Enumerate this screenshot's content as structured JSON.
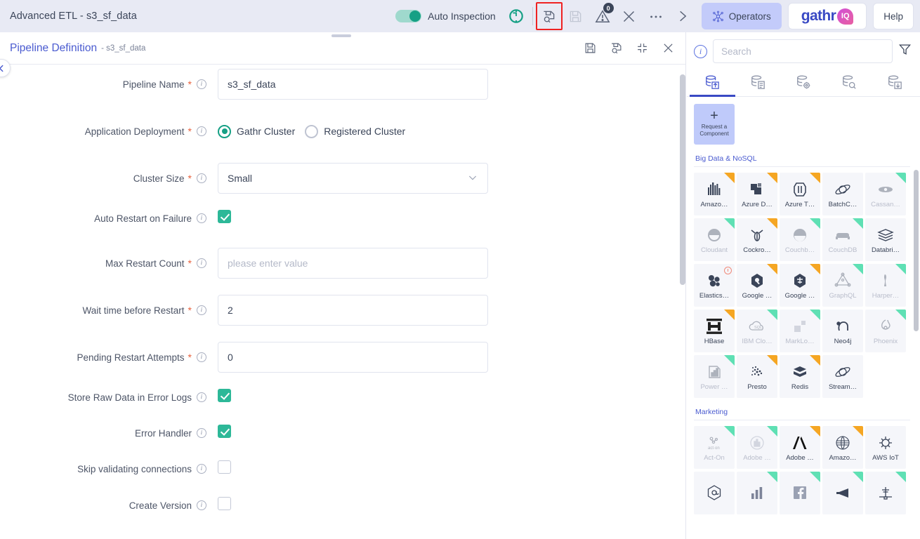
{
  "topbar": {
    "title": "Advanced ETL - s3_sf_data",
    "auto_inspection_label": "Auto Inspection",
    "icons": {
      "refresh": "refresh-icon",
      "save_as": "save-as-icon",
      "save": "save-icon",
      "warnings": "warning-icon",
      "close": "close-icon",
      "more": "more-icon",
      "next": "chevron-right-icon"
    },
    "warning_count": "0",
    "operators_label": "Operators",
    "gathr_label": "gathr",
    "gathr_iq_label": "IQ",
    "help_label": "Help",
    "accent": "#3949c4",
    "highlight_color": "#ef2222"
  },
  "panel": {
    "title": "Pipeline Definition",
    "subtitle": "- s3_sf_data",
    "actions": [
      "save-icon",
      "save-as-icon",
      "collapse-icon",
      "close-icon"
    ]
  },
  "form": {
    "fields": [
      {
        "label": "Pipeline Name",
        "required": true,
        "type": "text",
        "value": "s3_sf_data",
        "placeholder": ""
      },
      {
        "label": "Application Deployment",
        "required": true,
        "type": "radio",
        "options": [
          "Gathr Cluster",
          "Registered Cluster"
        ],
        "selected": "Gathr Cluster"
      },
      {
        "label": "Cluster Size",
        "required": true,
        "type": "select",
        "value": "Small"
      },
      {
        "label": "Auto Restart on Failure",
        "required": false,
        "type": "checkbox",
        "checked": true
      },
      {
        "label": "Max Restart Count",
        "required": true,
        "type": "text",
        "value": "",
        "placeholder": "please enter value"
      },
      {
        "label": "Wait time before Restart",
        "required": true,
        "type": "text",
        "value": "2",
        "placeholder": ""
      },
      {
        "label": "Pending Restart Attempts",
        "required": true,
        "type": "text",
        "value": "0",
        "placeholder": ""
      },
      {
        "label": "Store Raw Data in Error Logs",
        "required": false,
        "type": "checkbox",
        "checked": true
      },
      {
        "label": "Error Handler",
        "required": false,
        "type": "checkbox",
        "checked": true
      },
      {
        "label": "Skip validating connections",
        "required": false,
        "type": "checkbox",
        "checked": false
      },
      {
        "label": "Create Version",
        "required": false,
        "type": "checkbox",
        "checked": false
      }
    ]
  },
  "operators": {
    "search_placeholder": "Search",
    "info_icon": "info-icon",
    "filter_icon": "filter-icon",
    "tabs": [
      {
        "name": "sources-tab",
        "icon": "database-upload-icon",
        "active": true
      },
      {
        "name": "processors-tab",
        "icon": "database-document-icon",
        "active": false
      },
      {
        "name": "config-tab",
        "icon": "database-gear-icon",
        "active": false
      },
      {
        "name": "inspect-tab",
        "icon": "database-search-icon",
        "active": false
      },
      {
        "name": "emitters-tab",
        "icon": "database-download-icon",
        "active": false
      }
    ],
    "request_tile": {
      "plus": "+",
      "label": "Request a\nComponent"
    },
    "sections": [
      {
        "title": "Big Data & NoSQL",
        "items": [
          {
            "name": "Amazo…",
            "corner": "orange",
            "dim": false,
            "glyph": "amazon-redshift-icon"
          },
          {
            "name": "Azure D…",
            "corner": "orange",
            "dim": false,
            "glyph": "azure-data-icon"
          },
          {
            "name": "Azure T…",
            "corner": "orange",
            "dim": false,
            "glyph": "azure-table-icon"
          },
          {
            "name": "BatchC…",
            "corner": "none",
            "dim": false,
            "glyph": "batch-cosmos-icon"
          },
          {
            "name": "Cassan…",
            "corner": "green",
            "dim": true,
            "glyph": "cassandra-icon"
          },
          {
            "name": "Cloudant",
            "corner": "green",
            "dim": true,
            "glyph": "cloudant-icon"
          },
          {
            "name": "Cockro…",
            "corner": "orange",
            "dim": false,
            "glyph": "cockroachdb-icon"
          },
          {
            "name": "Couchb…",
            "corner": "green",
            "dim": true,
            "glyph": "couchbase-icon"
          },
          {
            "name": "CouchDB",
            "corner": "green",
            "dim": true,
            "glyph": "couchdb-icon"
          },
          {
            "name": "Databri…",
            "corner": "none",
            "dim": false,
            "glyph": "databricks-icon"
          },
          {
            "name": "Elastics…",
            "corner": "clock",
            "dim": false,
            "glyph": "elasticsearch-icon"
          },
          {
            "name": "Google …",
            "corner": "orange",
            "dim": false,
            "glyph": "google-bigquery-icon"
          },
          {
            "name": "Google …",
            "corner": "orange",
            "dim": false,
            "glyph": "google-bigtable-icon"
          },
          {
            "name": "GraphQL",
            "corner": "green",
            "dim": true,
            "glyph": "graphql-icon"
          },
          {
            "name": "Harper…",
            "corner": "green",
            "dim": true,
            "glyph": "harperdb-icon"
          },
          {
            "name": "HBase",
            "corner": "orange",
            "dim": false,
            "glyph": "hbase-icon"
          },
          {
            "name": "IBM Clo…",
            "corner": "green",
            "dim": true,
            "glyph": "ibm-cloud-sql-icon"
          },
          {
            "name": "MarkLo…",
            "corner": "green",
            "dim": true,
            "glyph": "marklogic-icon"
          },
          {
            "name": "Neo4j",
            "corner": "none",
            "dim": false,
            "glyph": "neo4j-icon"
          },
          {
            "name": "Phoenix",
            "corner": "green",
            "dim": true,
            "glyph": "phoenix-icon"
          },
          {
            "name": "Power …",
            "corner": "green",
            "dim": true,
            "glyph": "power-bi-icon"
          },
          {
            "name": "Presto",
            "corner": "orange",
            "dim": false,
            "glyph": "presto-icon"
          },
          {
            "name": "Redis",
            "corner": "orange",
            "dim": false,
            "glyph": "redis-icon"
          },
          {
            "name": "Stream…",
            "corner": "none",
            "dim": false,
            "glyph": "streamcosmos-icon"
          }
        ]
      },
      {
        "title": "Marketing",
        "items": [
          {
            "name": "Act-On",
            "corner": "green",
            "dim": true,
            "glyph": "act-on-icon"
          },
          {
            "name": "Adobe …",
            "corner": "green",
            "dim": true,
            "glyph": "adobe-analytics-icon"
          },
          {
            "name": "Adobe …",
            "corner": "orange",
            "dim": false,
            "glyph": "adobe-icon"
          },
          {
            "name": "Amazo…",
            "corner": "orange",
            "dim": false,
            "glyph": "amazon-marketing-icon"
          },
          {
            "name": "AWS IoT",
            "corner": "none",
            "dim": false,
            "glyph": "aws-iot-icon"
          },
          {
            "name": "",
            "corner": "none",
            "dim": false,
            "glyph": "at-hexagon-icon"
          },
          {
            "name": "",
            "corner": "green",
            "dim": false,
            "glyph": "bar-chart-icon"
          },
          {
            "name": "",
            "corner": "green",
            "dim": false,
            "glyph": "facebook-icon"
          },
          {
            "name": "",
            "corner": "green",
            "dim": false,
            "glyph": "megaphone-icon"
          },
          {
            "name": "",
            "corner": "green",
            "dim": false,
            "glyph": "antenna-icon"
          }
        ]
      }
    ]
  }
}
